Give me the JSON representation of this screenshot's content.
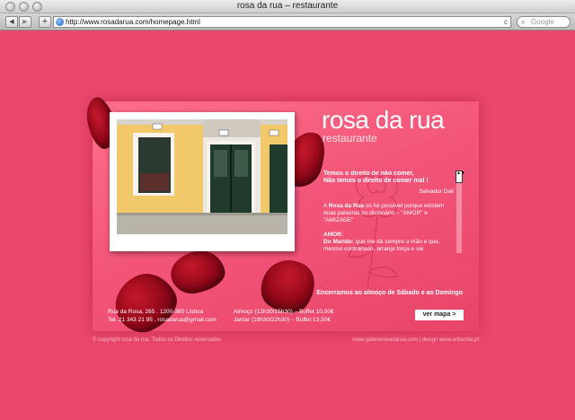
{
  "window": {
    "title": "rosa da rua – restaurante"
  },
  "toolbar": {
    "back_icon": "◀",
    "forward_icon": "▶",
    "add_icon": "+",
    "url": "http://www.rosadarua.com/homepage.html",
    "reload_icon": "c",
    "search_placeholder": "Google"
  },
  "page": {
    "brand_title": "rosa da rua",
    "brand_subtitle": "restaurante",
    "quote_line1": "Temos o direito de não comer,",
    "quote_line2": "Não temos o direito de comer mal !",
    "quote_author": "Salvador Dali",
    "para1_pre": "A ",
    "para1_bold": "Rosa da Rua",
    "para1_post": " só foi possível porque existem duas palavras no dicionário – \"AMOR\" e \"AMIZADE\"",
    "amor_heading": "AMOR:",
    "amor_bold": "Do Marido:",
    "amor_text": " que me dá sempre a mão e que, mesmo contrariado, arranja força e vai",
    "scroll_icon": "▲▼",
    "closed_note": "Encerramos ao almoço de Sábado e ao Domingo",
    "address_line1": "Rua da Rosa, 265 . 1200-385 Lisboa",
    "address_line2": "Tel. 21 343 21 95 . rosadarua@gmail.com",
    "hours_line1": "Almoço (12h30/15h30) – Buffet 10,00€",
    "hours_line2": "Jantar (19h30/22h30) – Buffet 13,50€",
    "map_button": "ver mapa >",
    "footer_left": "© copyright rosa da rua. Todos os Direitos reservados",
    "footer_right": "www.galeriarosadarua.com  |  design www.artlandia.pt"
  },
  "colors": {
    "background": "#e9476b",
    "card": "#f3567a",
    "petal": "#8e0717"
  }
}
